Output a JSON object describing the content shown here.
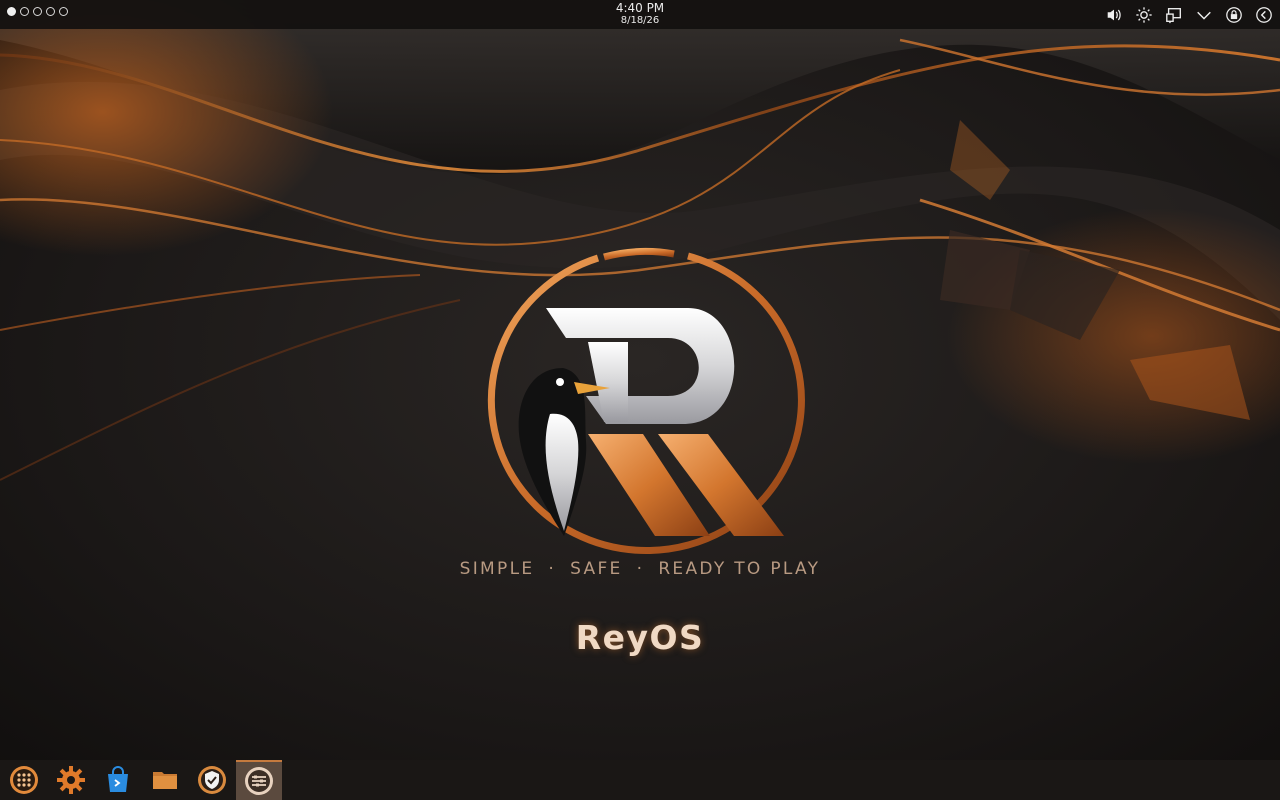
{
  "desktop": {
    "tagline": {
      "word1": "SIMPLE",
      "word2": "SAFE",
      "word3": "READY TO PLAY",
      "separator": "·"
    },
    "brand_name": "ReyOS"
  },
  "top_bar": {
    "workspaces": {
      "count": 5,
      "active_index": 0
    },
    "clock": {
      "time": "4:40 PM",
      "date": "8/18/26"
    },
    "tray": [
      "volume-icon",
      "brightness-icon",
      "network-icon",
      "expand-tray-icon",
      "lock-icon",
      "logout-icon"
    ]
  },
  "taskbar": {
    "items": [
      {
        "name": "app-grid-icon"
      },
      {
        "name": "settings-gear-icon"
      },
      {
        "name": "software-store-icon"
      },
      {
        "name": "file-manager-folder-icon"
      },
      {
        "name": "security-shield-icon"
      },
      {
        "name": "system-monitor-icon",
        "active": true
      }
    ]
  },
  "colors": {
    "accent_orange": "#d2782e",
    "tagline": "#b89a82",
    "brand": "#f0d9c4",
    "taskbar_bg": "#1a1715"
  }
}
